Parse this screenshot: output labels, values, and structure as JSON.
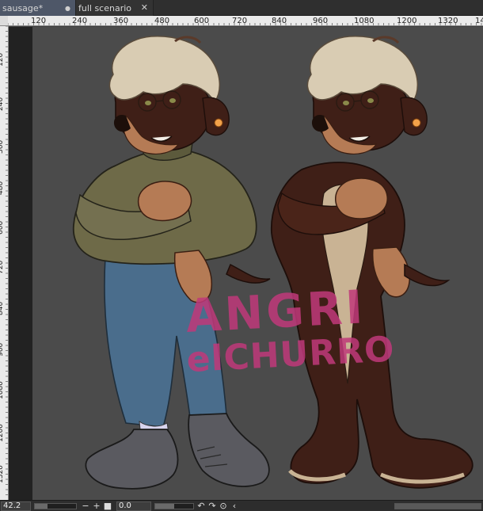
{
  "tabs": [
    {
      "label": "sausage*",
      "active": true,
      "close_icon": "modified-dot-icon"
    },
    {
      "label": "full scenario",
      "active": false,
      "close_icon": "close-icon"
    }
  ],
  "ruler": {
    "top_labels": [
      "120",
      "240",
      "360",
      "480",
      "600",
      "720",
      "840",
      "960",
      "1080",
      "1200",
      "1320",
      "14"
    ],
    "left_labels": [
      "120",
      "240",
      "360",
      "480",
      "600",
      "720",
      "840",
      "960",
      "1080",
      "1200",
      "1320",
      "14"
    ]
  },
  "watermark": {
    "line1": "ANGRI",
    "line2": "elCHURRO"
  },
  "status": {
    "zoom": "42.2",
    "rotation": "0.0",
    "icons": [
      "zoom-out-icon",
      "zoom-in-icon",
      "fit-icon",
      "rotate-left-icon",
      "rotate-right-icon",
      "reset-rotation-icon",
      "collapse-icon"
    ]
  },
  "colors": {
    "canvas_bg": "#4b4b4b",
    "tab_active": "#4e5768",
    "watermark": "#c0397a",
    "fur_brown": "#3f1f17",
    "fur_tan": "#b57b55",
    "hair_cream": "#d9ccb3",
    "sweater": "#6e6a48",
    "jeans": "#4a6d8c",
    "shoes": "#5a5a60"
  }
}
